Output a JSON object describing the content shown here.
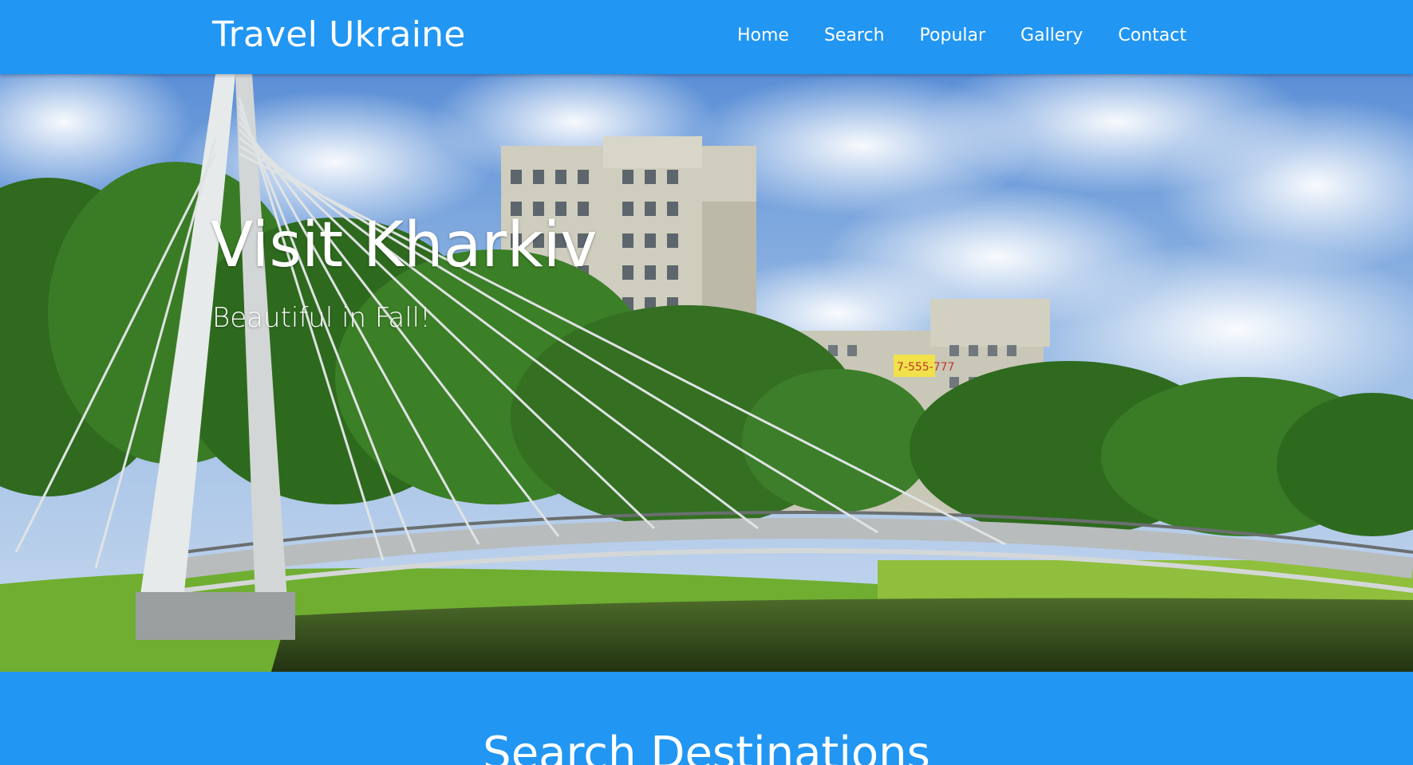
{
  "nav": {
    "brand": "Travel Ukraine",
    "links": [
      "Home",
      "Search",
      "Popular",
      "Gallery",
      "Contact"
    ]
  },
  "hero": {
    "title": "Visit Kharkiv",
    "subtitle": "Beautiful in Fall!",
    "billboard_text": "7-555-777"
  },
  "search": {
    "heading": "Search Destinations"
  },
  "colors": {
    "primary": "#2196f3",
    "text": "#ffffff"
  }
}
